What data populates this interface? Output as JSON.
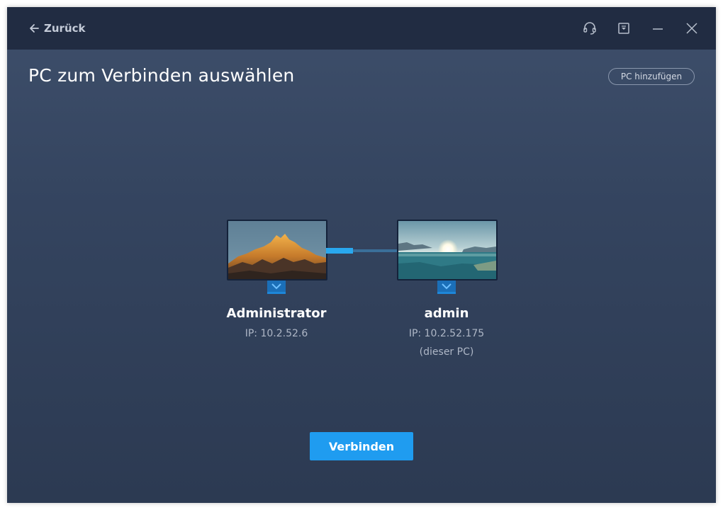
{
  "titlebar": {
    "back_label": "Zurück",
    "icons": [
      "arrow-left-icon",
      "headset-icon",
      "download-icon",
      "minimize-icon",
      "close-icon"
    ]
  },
  "page": {
    "title": "PC zum Verbinden auswählen",
    "add_pc_label": "PC hinzufügen"
  },
  "pcs": [
    {
      "name": "Administrator",
      "ip": "IP: 10.2.52.6",
      "note": "",
      "wallpaper": "mountain-peak-image"
    },
    {
      "name": "admin",
      "ip": "IP: 10.2.52.175",
      "note": "(dieser PC)",
      "wallpaper": "lake-sunrise-image"
    }
  ],
  "connect_label": "Verbinden",
  "colors": {
    "titlebar_bg": "#212c42",
    "window_bg": "#3e4f6b",
    "accent": "#1f9cf0",
    "link_active": "#29a8ef"
  }
}
